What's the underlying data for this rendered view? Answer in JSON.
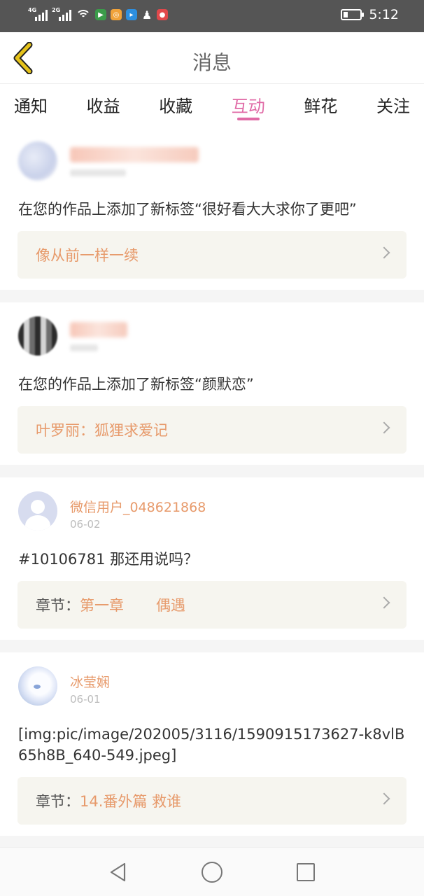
{
  "status_bar": {
    "network_1": "4G",
    "network_2": "2G",
    "time": "5:12",
    "icons": [
      "signal-icon",
      "signal-icon",
      "wifi-icon",
      "app-icon",
      "app-icon",
      "app-icon",
      "qq-icon",
      "app-icon"
    ]
  },
  "header": {
    "title": "消息",
    "back_icon": "chevron-left-icon",
    "accent_color": "#e5c21a"
  },
  "tabs": [
    {
      "label": "通知",
      "active": false
    },
    {
      "label": "收益",
      "active": false
    },
    {
      "label": "收藏",
      "active": false
    },
    {
      "label": "互动",
      "active": true
    },
    {
      "label": "鲜花",
      "active": false
    },
    {
      "label": "关注",
      "active": false
    }
  ],
  "tab_active_color": "#e06aa6",
  "messages": [
    {
      "user": "",
      "date": "",
      "content": "在您的作品上添加了新标签“很好看大大求你了更吧”",
      "link_label": "",
      "link_value": "像从前一样一续"
    },
    {
      "user": "",
      "date": "",
      "content": "在您的作品上添加了新标签“颜默恋”",
      "link_label": "",
      "link_value": "叶罗丽：狐狸求爱记"
    },
    {
      "user": "微信用户_048621868",
      "date": "06-02",
      "content": "#10106781 那还用说吗？",
      "link_label": "章节：",
      "link_value": "第一章",
      "link_value_2": "偶遇"
    },
    {
      "user": "冰莹娴",
      "date": "06-01",
      "content": "[img:pic/image/202005/3116/1590915173627-k8vlB65h8B_640-549.jpeg]",
      "link_label": "章节：",
      "link_value": "14.番外篇 救谁"
    }
  ],
  "colors": {
    "username": "#e79a6b",
    "link_bg": "#f6f5ef"
  },
  "nav_bar": {
    "back": "triangle-back-icon",
    "home": "circle-home-icon",
    "recent": "square-recent-icon"
  }
}
